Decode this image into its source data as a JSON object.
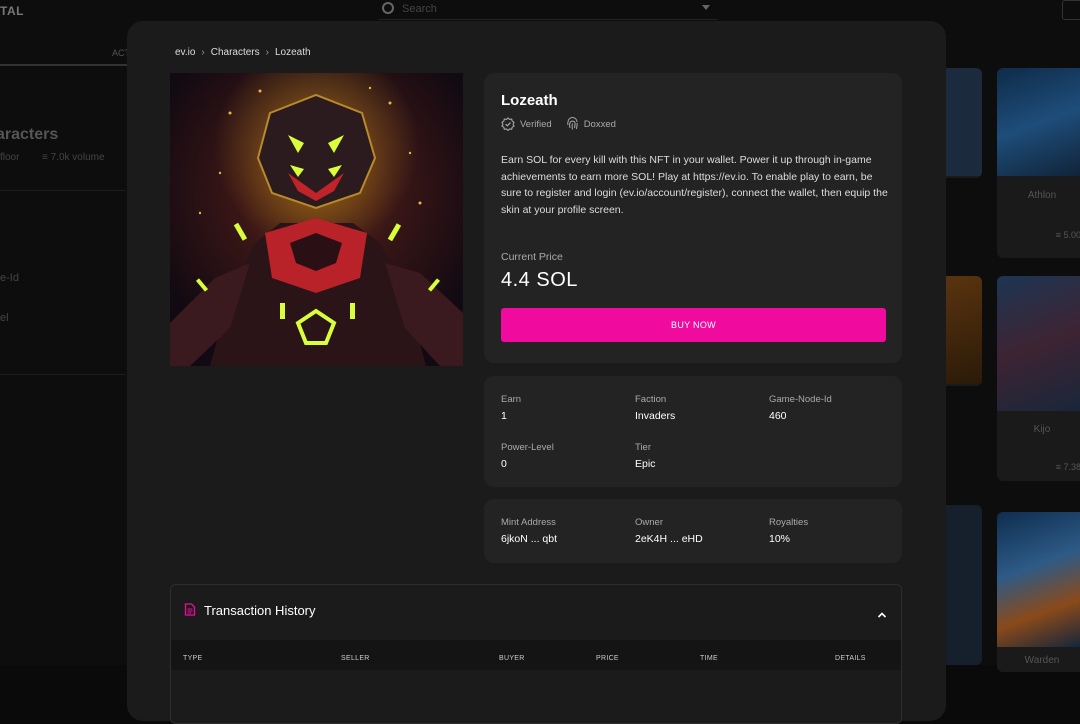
{
  "background": {
    "logo": "TAL",
    "search_placeholder": "Search",
    "tab_left": "",
    "tab_activity": "ACT",
    "collection_title": "aracters",
    "stat_floor": "floor",
    "stat_volume": "7.0k volume",
    "filter_1": "e-Id",
    "filter_2": "el",
    "cards": [
      {
        "name": "",
        "price": ""
      },
      {
        "name": "Athlon",
        "price": "5.00"
      },
      {
        "name": "",
        "price": ""
      },
      {
        "name": "Kijo",
        "price": "7.38"
      },
      {
        "name": "",
        "price": ""
      },
      {
        "name": "Warden",
        "price": ""
      }
    ]
  },
  "breadcrumb": {
    "items": [
      "ev.io",
      "Characters",
      "Lozeath"
    ],
    "separator": "›"
  },
  "nft": {
    "name": "Lozeath",
    "badges": [
      "Verified",
      "Doxxed"
    ],
    "description": "Earn SOL for every kill with this NFT in your wallet. Power it up through in-game achievements to earn more SOL! Play at https://ev.io. To enable play to earn, be sure to register and login (ev.io/account/register), connect the wallet, then equip the skin at your profile screen.",
    "price_label": "Current Price",
    "price_value": "4.4 SOL",
    "buy_label": "BUY NOW"
  },
  "attributes": [
    {
      "key": "Earn",
      "value": "1"
    },
    {
      "key": "Faction",
      "value": "Invaders"
    },
    {
      "key": "Game-Node-Id",
      "value": "460"
    },
    {
      "key": "Power-Level",
      "value": "0"
    },
    {
      "key": "Tier",
      "value": "Epic"
    }
  ],
  "info": [
    {
      "key": "Mint Address",
      "value": "6jkoN ... qbt"
    },
    {
      "key": "Owner",
      "value": "2eK4H ... eHD"
    },
    {
      "key": "Royalties",
      "value": "10%"
    }
  ],
  "transactions": {
    "title": "Transaction History",
    "columns": [
      "TYPE",
      "SELLER",
      "BUYER",
      "PRICE",
      "TIME",
      "DETAILS"
    ]
  },
  "colors": {
    "accent": "#f00a9e",
    "modal_bg": "#1b1b1b",
    "panel_bg": "#232323"
  }
}
